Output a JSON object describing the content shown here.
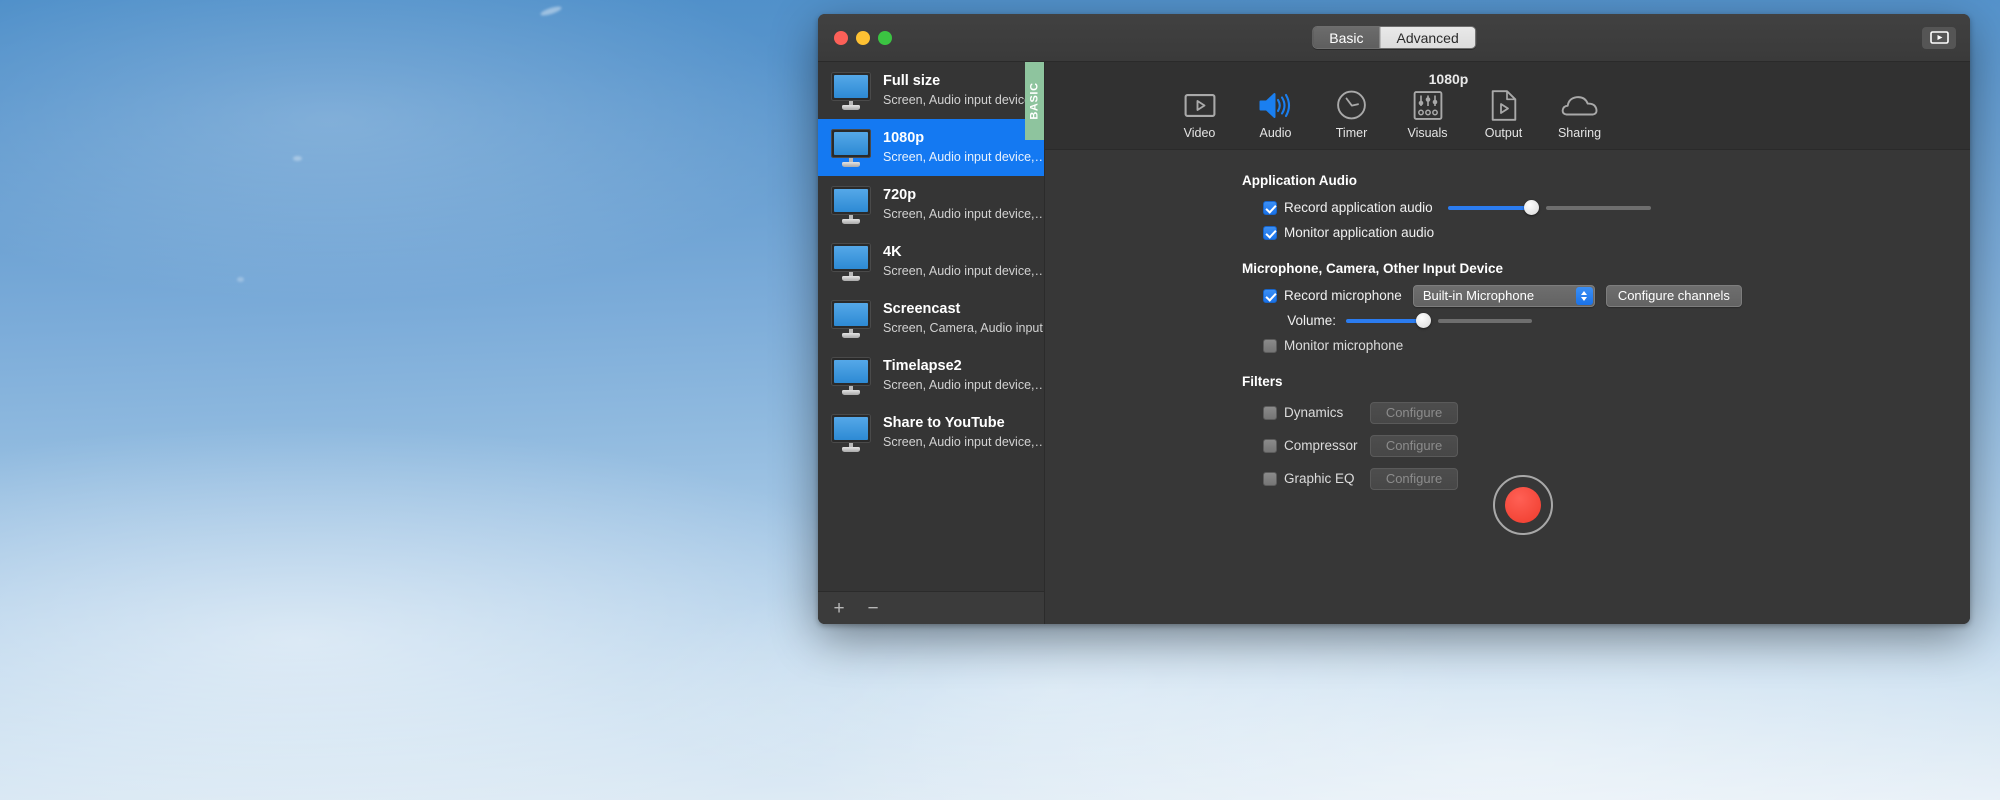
{
  "window": {
    "traffic_lights": [
      "close",
      "minimize",
      "zoom"
    ],
    "mode_tabs": [
      {
        "label": "Basic",
        "selected": false
      },
      {
        "label": "Advanced",
        "selected": true
      }
    ],
    "right_button_icon": "video-play-icon"
  },
  "sidebar": {
    "badge": "BASIC",
    "presets": [
      {
        "title": "Full size",
        "subtitle": "Screen, Audio input device",
        "selected": false
      },
      {
        "title": "1080p",
        "subtitle": "Screen, Audio input device,…",
        "selected": true
      },
      {
        "title": "720p",
        "subtitle": "Screen, Audio input device,…",
        "selected": false
      },
      {
        "title": "4K",
        "subtitle": "Screen, Audio input device,…",
        "selected": false
      },
      {
        "title": "Screencast",
        "subtitle": "Screen, Camera, Audio input…",
        "selected": false
      },
      {
        "title": "Timelapse2",
        "subtitle": "Screen, Audio input device,…",
        "selected": false
      },
      {
        "title": "Share to YouTube",
        "subtitle": "Screen, Audio input device,…",
        "selected": false
      }
    ],
    "footer": {
      "add_label": "+",
      "remove_label": "−"
    }
  },
  "toolbar": {
    "title": "1080p",
    "items": [
      {
        "label": "Video",
        "icon": "video-icon",
        "selected": false
      },
      {
        "label": "Audio",
        "icon": "speaker-icon",
        "selected": true
      },
      {
        "label": "Timer",
        "icon": "clock-icon",
        "selected": false
      },
      {
        "label": "Visuals",
        "icon": "sliders-icon",
        "selected": false
      },
      {
        "label": "Output",
        "icon": "file-play-icon",
        "selected": false
      },
      {
        "label": "Sharing",
        "icon": "cloud-icon",
        "selected": false
      }
    ]
  },
  "settings": {
    "application_audio": {
      "heading": "Application Audio",
      "record_label": "Record application audio",
      "record_checked": true,
      "record_volume_percent": 46,
      "monitor_label": "Monitor application audio",
      "monitor_checked": true
    },
    "input_device": {
      "heading": "Microphone, Camera, Other Input Device",
      "record_mic_label": "Record microphone",
      "record_mic_checked": true,
      "device_value": "Built-in Microphone",
      "configure_channels_label": "Configure channels",
      "volume_label": "Volume:",
      "volume_percent": 42,
      "monitor_mic_label": "Monitor microphone",
      "monitor_mic_checked": false
    },
    "filters": {
      "heading": "Filters",
      "rows": [
        {
          "label": "Dynamics",
          "checked": false,
          "button": "Configure",
          "button_disabled": true
        },
        {
          "label": "Compressor",
          "checked": false,
          "button": "Configure",
          "button_disabled": true
        },
        {
          "label": "Graphic EQ",
          "checked": false,
          "button": "Configure",
          "button_disabled": true
        }
      ]
    },
    "record_button": {
      "icon": "record-dot-icon"
    }
  },
  "colors": {
    "accent_blue": "#1479f2",
    "slider_blue": "#2b7cf0",
    "record_red": "#ef3b2c",
    "badge_green": "#8ec49e"
  }
}
